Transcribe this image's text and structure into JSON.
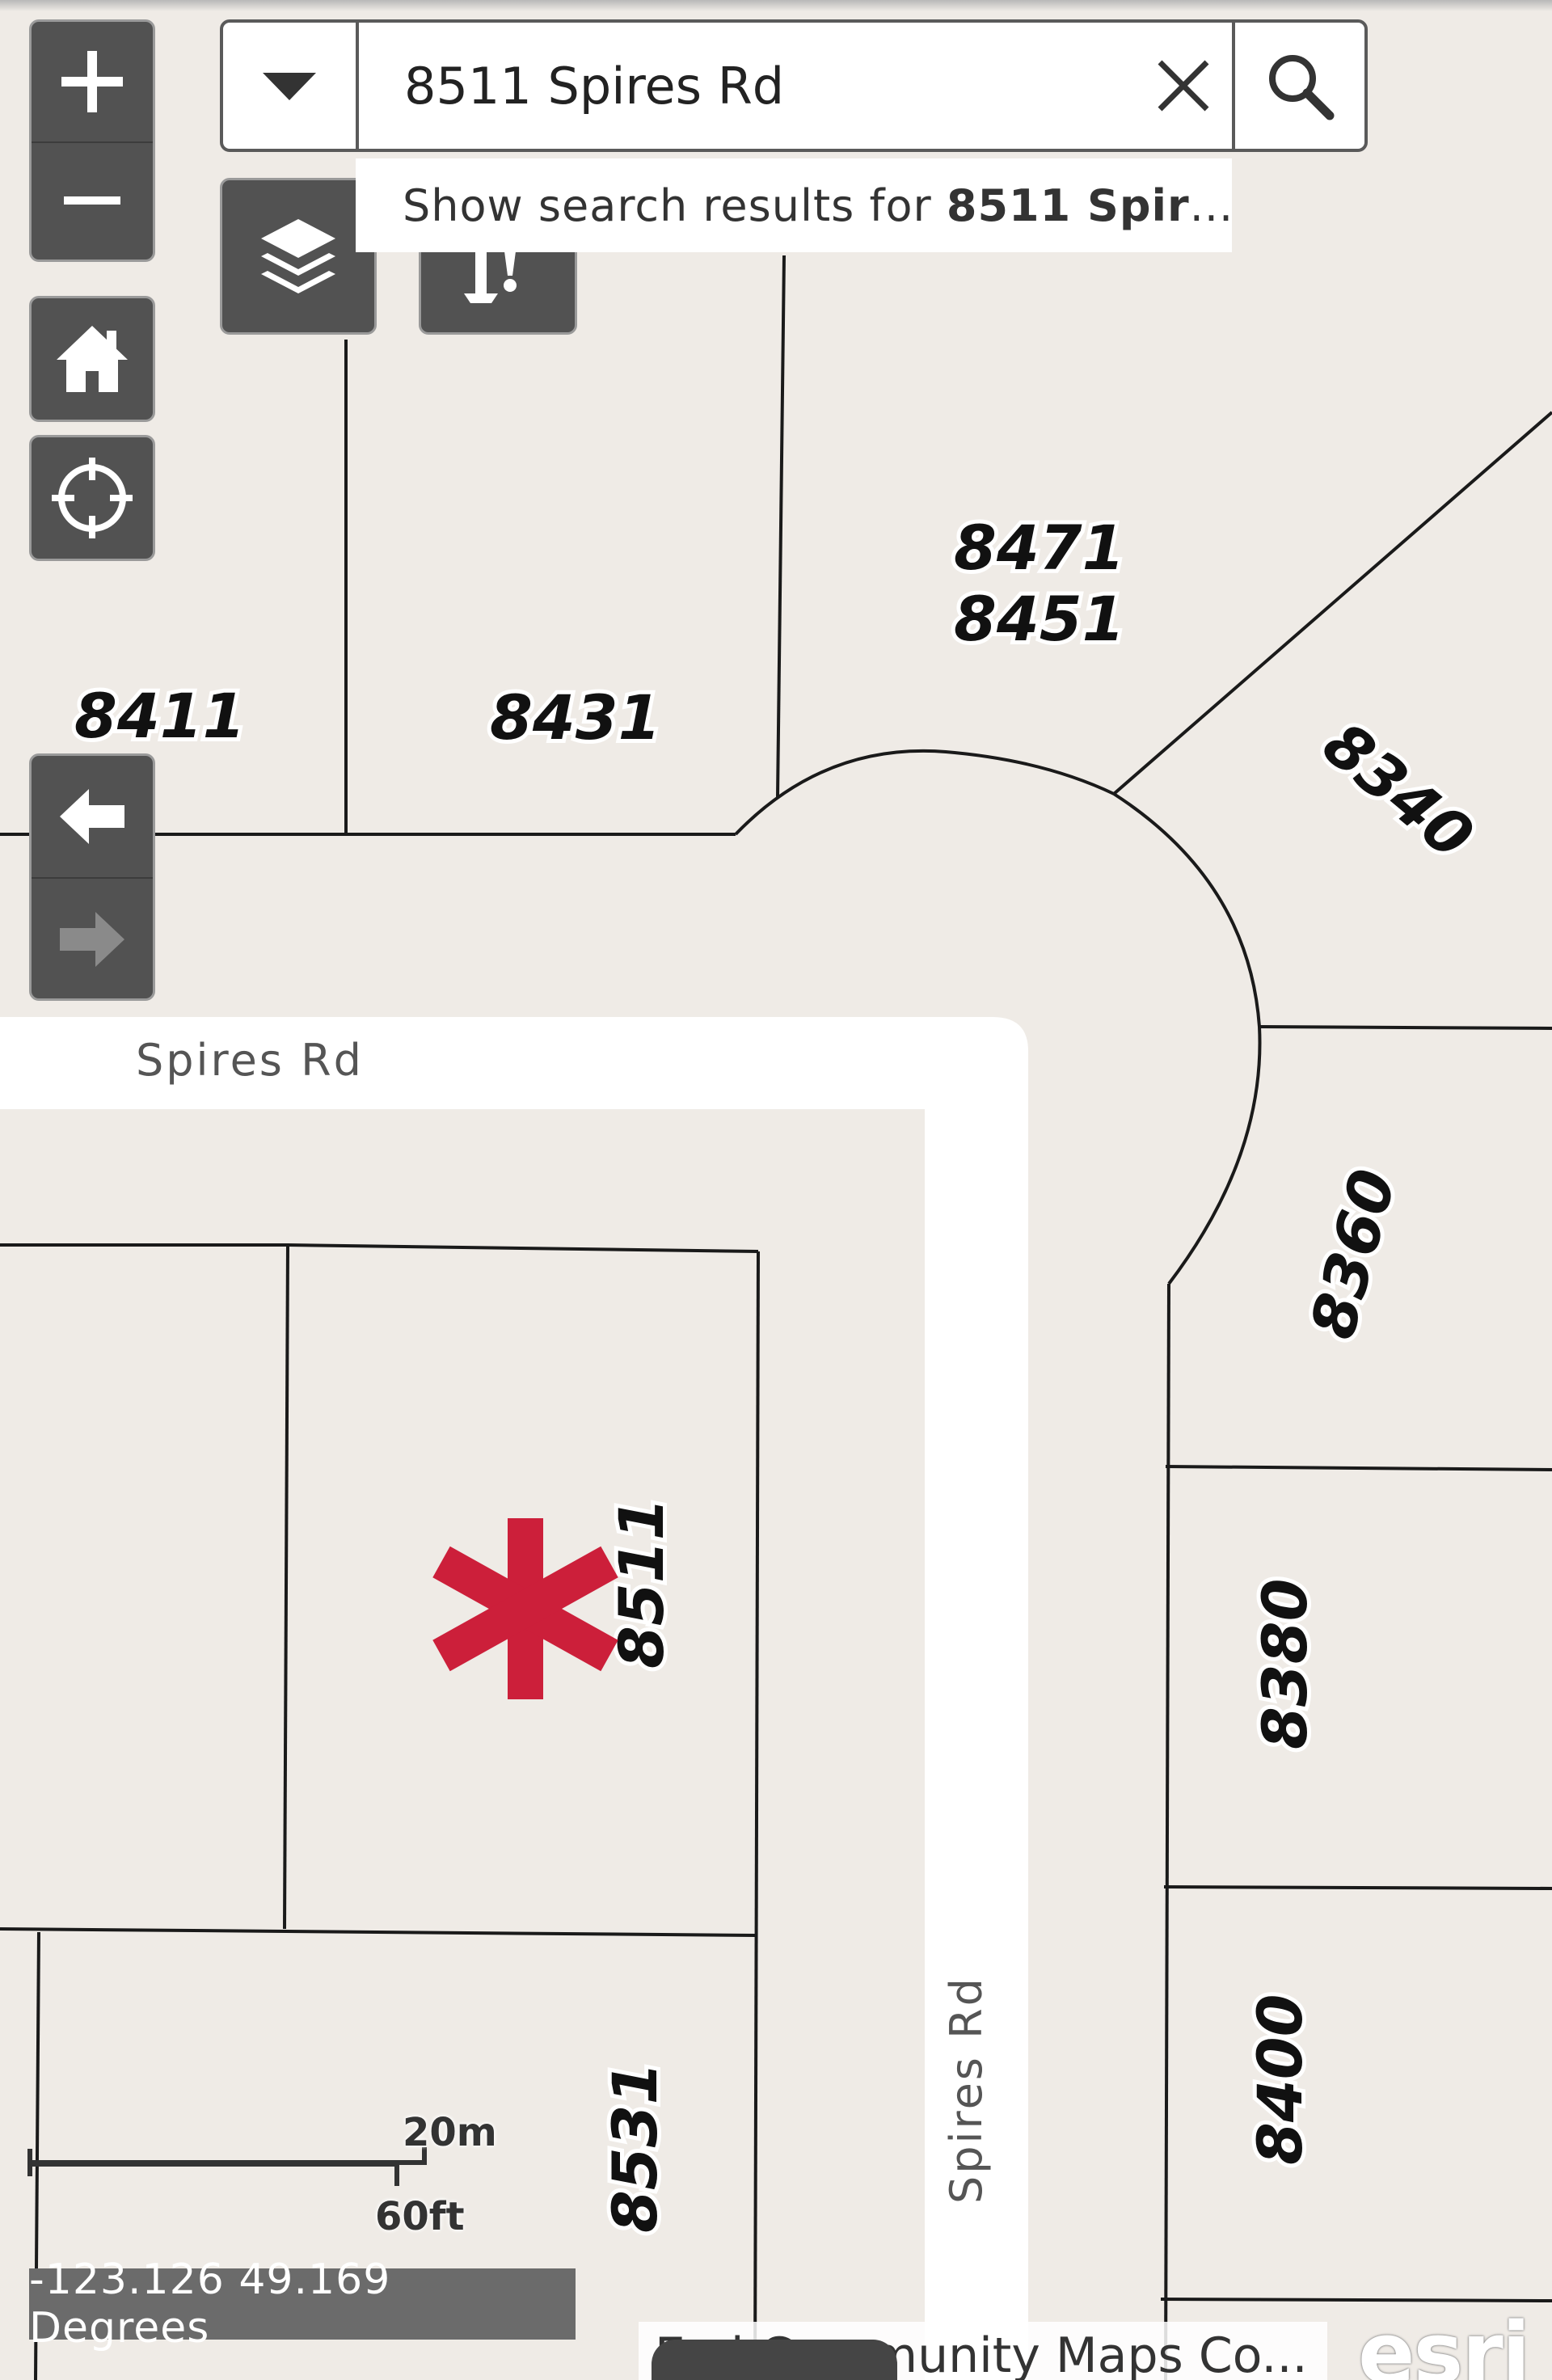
{
  "search": {
    "value": "8511 Spires Rd",
    "suggestion_prefix": "Show search results for ",
    "suggestion_bold": "8511 Spir",
    "suggestion_suffix": "..."
  },
  "parcels": {
    "p8411": "8411",
    "p8431": "8431",
    "p8471": "8471",
    "p8451": "8451",
    "p8340": "8340",
    "p8360": "8360",
    "p8511": "8511",
    "p8380": "8380",
    "p8531": "8531",
    "p8400": "8400"
  },
  "streets": {
    "horizontal": "Spires Rd",
    "vertical": "Spires Rd"
  },
  "scale": {
    "metric": "20m",
    "imperial": "60ft"
  },
  "coordinates": "-123.126 49.169 Degrees",
  "attribution": "Esri Community Maps Co...",
  "logo": "esri",
  "colors": {
    "map_background": "#efebe6",
    "road": "#ffffff",
    "parcel_line": "#1a1a1a",
    "marker": "#cc1f3a",
    "control": "#525252"
  },
  "icons": {
    "zoom_in": "plus-icon",
    "zoom_out": "minus-icon",
    "home": "home-icon",
    "locate": "crosshair-icon",
    "back": "arrow-left-icon",
    "forward": "arrow-right-icon",
    "layers": "layers-icon",
    "tool": "tool-icon",
    "dropdown": "caret-down-icon",
    "clear": "close-icon",
    "search": "search-icon",
    "marker": "asterisk-marker-icon"
  }
}
